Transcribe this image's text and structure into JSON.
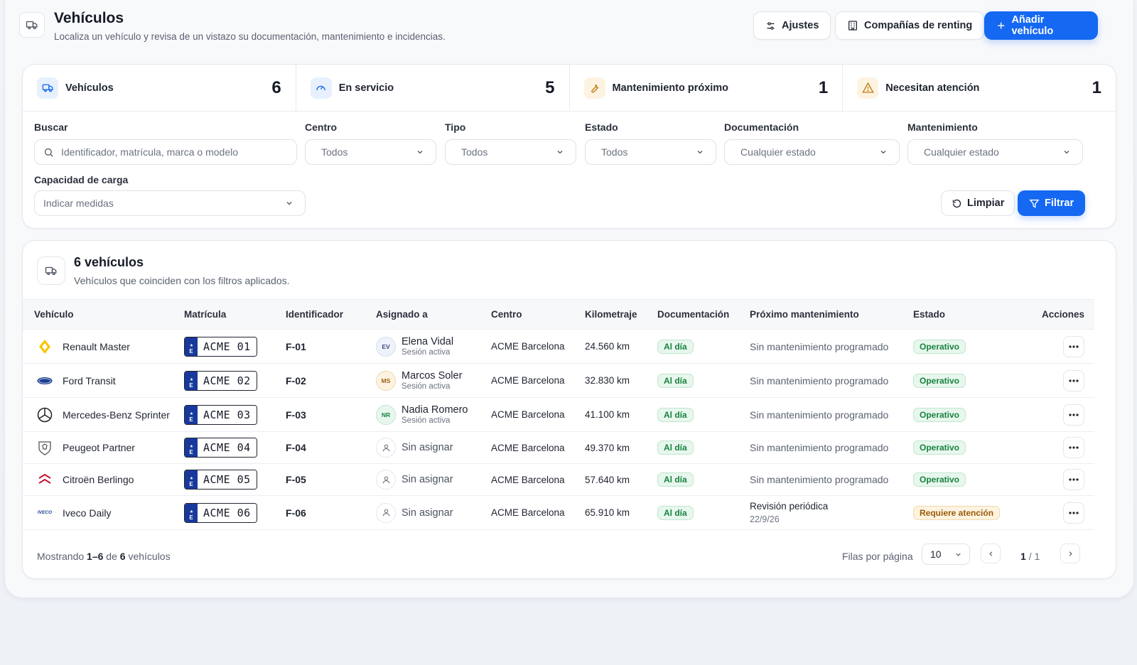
{
  "header": {
    "title": "Vehículos",
    "subtitle": "Localiza un vehículo y revisa de un vistazo su documentación, mantenimiento e incidencias.",
    "settings_label": "Ajustes",
    "renting_label": "Compañías de renting",
    "add_label": "Añadir vehículo"
  },
  "stats": [
    {
      "label": "Vehículos",
      "value": "6",
      "icon": "truck-icon"
    },
    {
      "label": "En servicio",
      "value": "5",
      "icon": "gauge-icon"
    },
    {
      "label": "Mantenimiento próximo",
      "value": "1",
      "icon": "wrench-icon"
    },
    {
      "label": "Necesitan atención",
      "value": "1",
      "icon": "warning-icon"
    }
  ],
  "filters": {
    "search_label": "Buscar",
    "search_placeholder": "Identificador, matrícula, marca o modelo",
    "centro_label": "Centro",
    "centro_value": "Todos",
    "tipo_label": "Tipo",
    "tipo_value": "Todos",
    "estado_label": "Estado",
    "estado_value": "Todos",
    "doc_label": "Documentación",
    "doc_value": "Cualquier estado",
    "mant_label": "Mantenimiento",
    "mant_value": "Cualquier estado",
    "carga_label": "Capacidad de carga",
    "carga_value": "Indicar medidas",
    "clear_label": "Limpiar",
    "filter_label": "Filtrar"
  },
  "results": {
    "title": "6 vehículos",
    "subtitle": "Vehículos que coinciden con los filtros aplicados.",
    "columns": [
      "Vehículo",
      "Matrícula",
      "Identificador",
      "Asignado a",
      "Centro",
      "Kilometraje",
      "Documentación",
      "Próximo mantenimiento",
      "Estado",
      "Acciones"
    ],
    "rows": [
      {
        "brand": "renault-logo-icon",
        "name": "Renault Master",
        "plate": "ACME 01",
        "id": "F-01",
        "initials": "EV",
        "assigned": "Elena Vidal",
        "session": "Sesión activa",
        "centro": "ACME Barcelona",
        "km": "24.560 km",
        "doc": "Al día",
        "maint": "Sin mantenimiento programado",
        "maint_date": "",
        "status": "Operativo"
      },
      {
        "brand": "ford-logo-icon",
        "name": "Ford Transit",
        "plate": "ACME 02",
        "id": "F-02",
        "initials": "MS",
        "assigned": "Marcos Soler",
        "session": "Sesión activa",
        "centro": "ACME Barcelona",
        "km": "32.830 km",
        "doc": "Al día",
        "maint": "Sin mantenimiento programado",
        "maint_date": "",
        "status": "Operativo"
      },
      {
        "brand": "mercedes-logo-icon",
        "name": "Mercedes-Benz Sprinter",
        "plate": "ACME 03",
        "id": "F-03",
        "initials": "NR",
        "assigned": "Nadia Romero",
        "session": "Sesión activa",
        "centro": "ACME Barcelona",
        "km": "41.100 km",
        "doc": "Al día",
        "maint": "Sin mantenimiento programado",
        "maint_date": "",
        "status": "Operativo"
      },
      {
        "brand": "peugeot-logo-icon",
        "name": "Peugeot Partner",
        "plate": "ACME 04",
        "id": "F-04",
        "initials": "",
        "assigned": "Sin asignar",
        "session": "",
        "centro": "ACME Barcelona",
        "km": "49.370 km",
        "doc": "Al día",
        "maint": "Sin mantenimiento programado",
        "maint_date": "",
        "status": "Operativo"
      },
      {
        "brand": "citroen-logo-icon",
        "name": "Citroën Berlingo",
        "plate": "ACME 05",
        "id": "F-05",
        "initials": "",
        "assigned": "Sin asignar",
        "session": "",
        "centro": "ACME Barcelona",
        "km": "57.640 km",
        "doc": "Al día",
        "maint": "Sin mantenimiento programado",
        "maint_date": "",
        "status": "Operativo"
      },
      {
        "brand": "iveco-logo-icon",
        "name": "Iveco Daily",
        "plate": "ACME 06",
        "id": "F-06",
        "initials": "",
        "assigned": "Sin asignar",
        "session": "",
        "centro": "ACME Barcelona",
        "km": "65.910 km",
        "doc": "Al día",
        "maint": "Revisión periódica",
        "maint_date": "22/9/26",
        "status": "Requiere atención"
      }
    ],
    "plate_letter": "E",
    "iveco_text": "IVECO",
    "showing_prefix": "Mostrando",
    "showing_range": "1–6",
    "showing_mid": "de",
    "showing_total": "6",
    "showing_suffix": "vehículos",
    "rows_per_page_label": "Filas por página",
    "rows_per_page_value": "10",
    "page_current": "1",
    "page_total": "/ 1"
  },
  "colors": {
    "primary": "#1468f2",
    "ok_green": "#16833f",
    "warn_amber": "#9a5a05"
  }
}
